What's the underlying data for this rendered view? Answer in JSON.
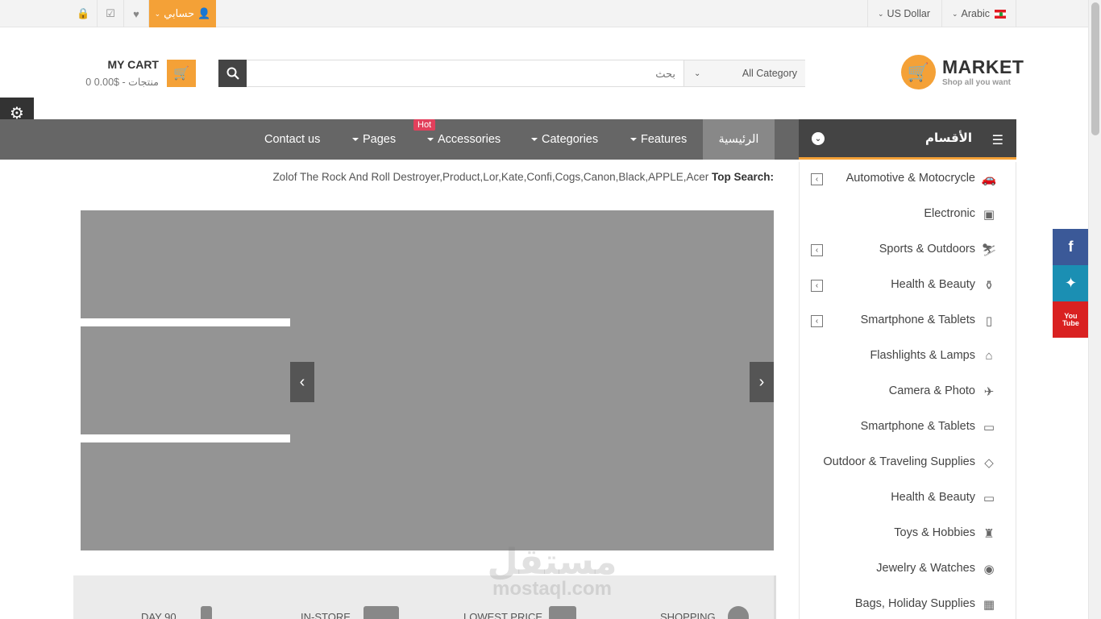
{
  "topbar": {
    "account_label": "حسابي",
    "currency_label": "US Dollar",
    "language_label": "Arabic"
  },
  "header": {
    "logo_title": "MARKET",
    "logo_subtitle": "Shop all you want",
    "search_placeholder": "بحث",
    "search_category": "All Category",
    "cart_title": "MY CART",
    "cart_summary": "0 منتجات - $0.00"
  },
  "nav": {
    "items": [
      "الرئيسية",
      "Features",
      "Categories",
      "Accessories",
      "Pages",
      "Contact us"
    ],
    "hot_badge": "Hot"
  },
  "categories": {
    "title": "الأقسام",
    "items": [
      {
        "label": "Automotive & Motocrycle",
        "icon": "car-icon",
        "glyph": "🚗",
        "has_sub": true
      },
      {
        "label": "Electronic",
        "icon": "speaker-icon",
        "glyph": "▣",
        "has_sub": false
      },
      {
        "label": "Sports & Outdoors",
        "icon": "ski-icon",
        "glyph": "⛷",
        "has_sub": true
      },
      {
        "label": "Health & Beauty",
        "icon": "bottle-icon",
        "glyph": "⚱",
        "has_sub": true
      },
      {
        "label": "Smartphone & Tablets",
        "icon": "phone-icon",
        "glyph": "▯",
        "has_sub": true
      },
      {
        "label": "Flashlights & Lamps",
        "icon": "lamp-icon",
        "glyph": "⌂",
        "has_sub": false
      },
      {
        "label": "Camera & Photo",
        "icon": "helicopter-icon",
        "glyph": "✈",
        "has_sub": false
      },
      {
        "label": "Smartphone & Tablets",
        "icon": "monitor-icon",
        "glyph": "▭",
        "has_sub": false
      },
      {
        "label": "Outdoor & Traveling Supplies",
        "icon": "diamond-icon",
        "glyph": "◇",
        "has_sub": false
      },
      {
        "label": "Health & Beauty",
        "icon": "laptop-icon",
        "glyph": "▭",
        "has_sub": false
      },
      {
        "label": "Toys & Hobbies",
        "icon": "flashlight-icon",
        "glyph": "♜",
        "has_sub": false
      },
      {
        "label": "Jewelry & Watches",
        "icon": "camera-icon",
        "glyph": "◉",
        "has_sub": false
      },
      {
        "label": "Bags, Holiday Supplies",
        "icon": "gift-icon",
        "glyph": "▦",
        "has_sub": false
      }
    ]
  },
  "top_search": {
    "label": "Top Search:",
    "terms": "Zolof The Rock And Roll Destroyer,Product,Lor,Kate,Confi,Cogs,Canon,Black,APPLE,Acer"
  },
  "features": [
    "SHOPPING",
    "LOWEST PRICE",
    "IN-STORE",
    "DAY 90"
  ],
  "social": [
    "f",
    "t",
    "You Tube"
  ],
  "watermark": {
    "arabic": "مستقل",
    "latin": "mostaql.com"
  },
  "colors": {
    "accent": "#f4a137",
    "nav": "#666666",
    "nav_active": "#888888",
    "cat_header": "#444444",
    "facebook": "#3b5998",
    "twitter": "#1b8fb3",
    "youtube": "#d92121",
    "hot": "#e2405c"
  }
}
